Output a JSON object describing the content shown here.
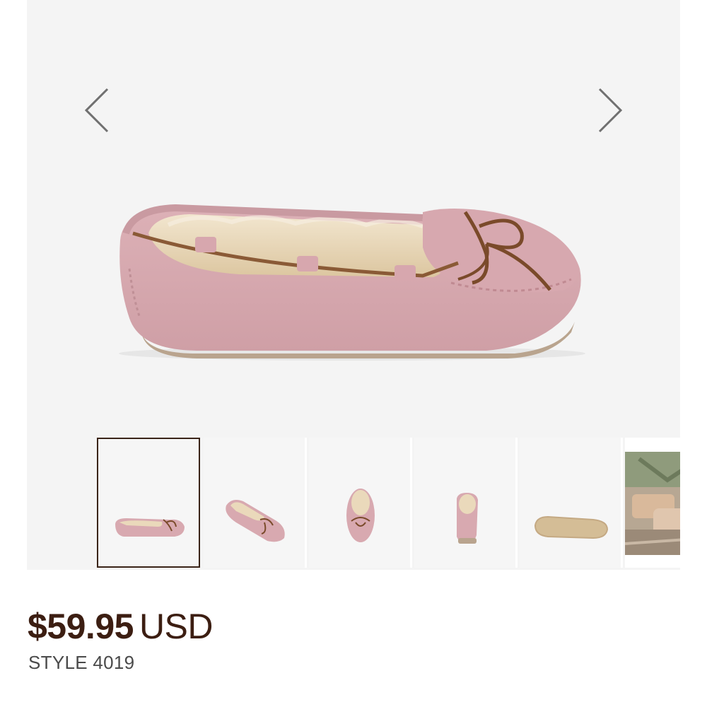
{
  "product": {
    "images": [
      {
        "name": "side-view",
        "selected": true
      },
      {
        "name": "angle-view",
        "selected": false
      },
      {
        "name": "top-view",
        "selected": false
      },
      {
        "name": "back-view",
        "selected": false
      },
      {
        "name": "sole-view",
        "selected": false
      },
      {
        "name": "lifestyle-photo",
        "selected": false
      }
    ],
    "price_amount": "$59.95",
    "price_currency": "USD",
    "style": "STYLE 4019"
  },
  "icons": {
    "prev": "chevron-left-icon",
    "next": "chevron-right-icon"
  },
  "colors": {
    "price_text": "#3c1e12",
    "selected_thumb_border": "#3a2418",
    "suede_pink": "#d9aab1",
    "fur_cream": "#ecdcc0",
    "lace_brown": "#7a4a2a",
    "arrow_gray": "#707070"
  }
}
